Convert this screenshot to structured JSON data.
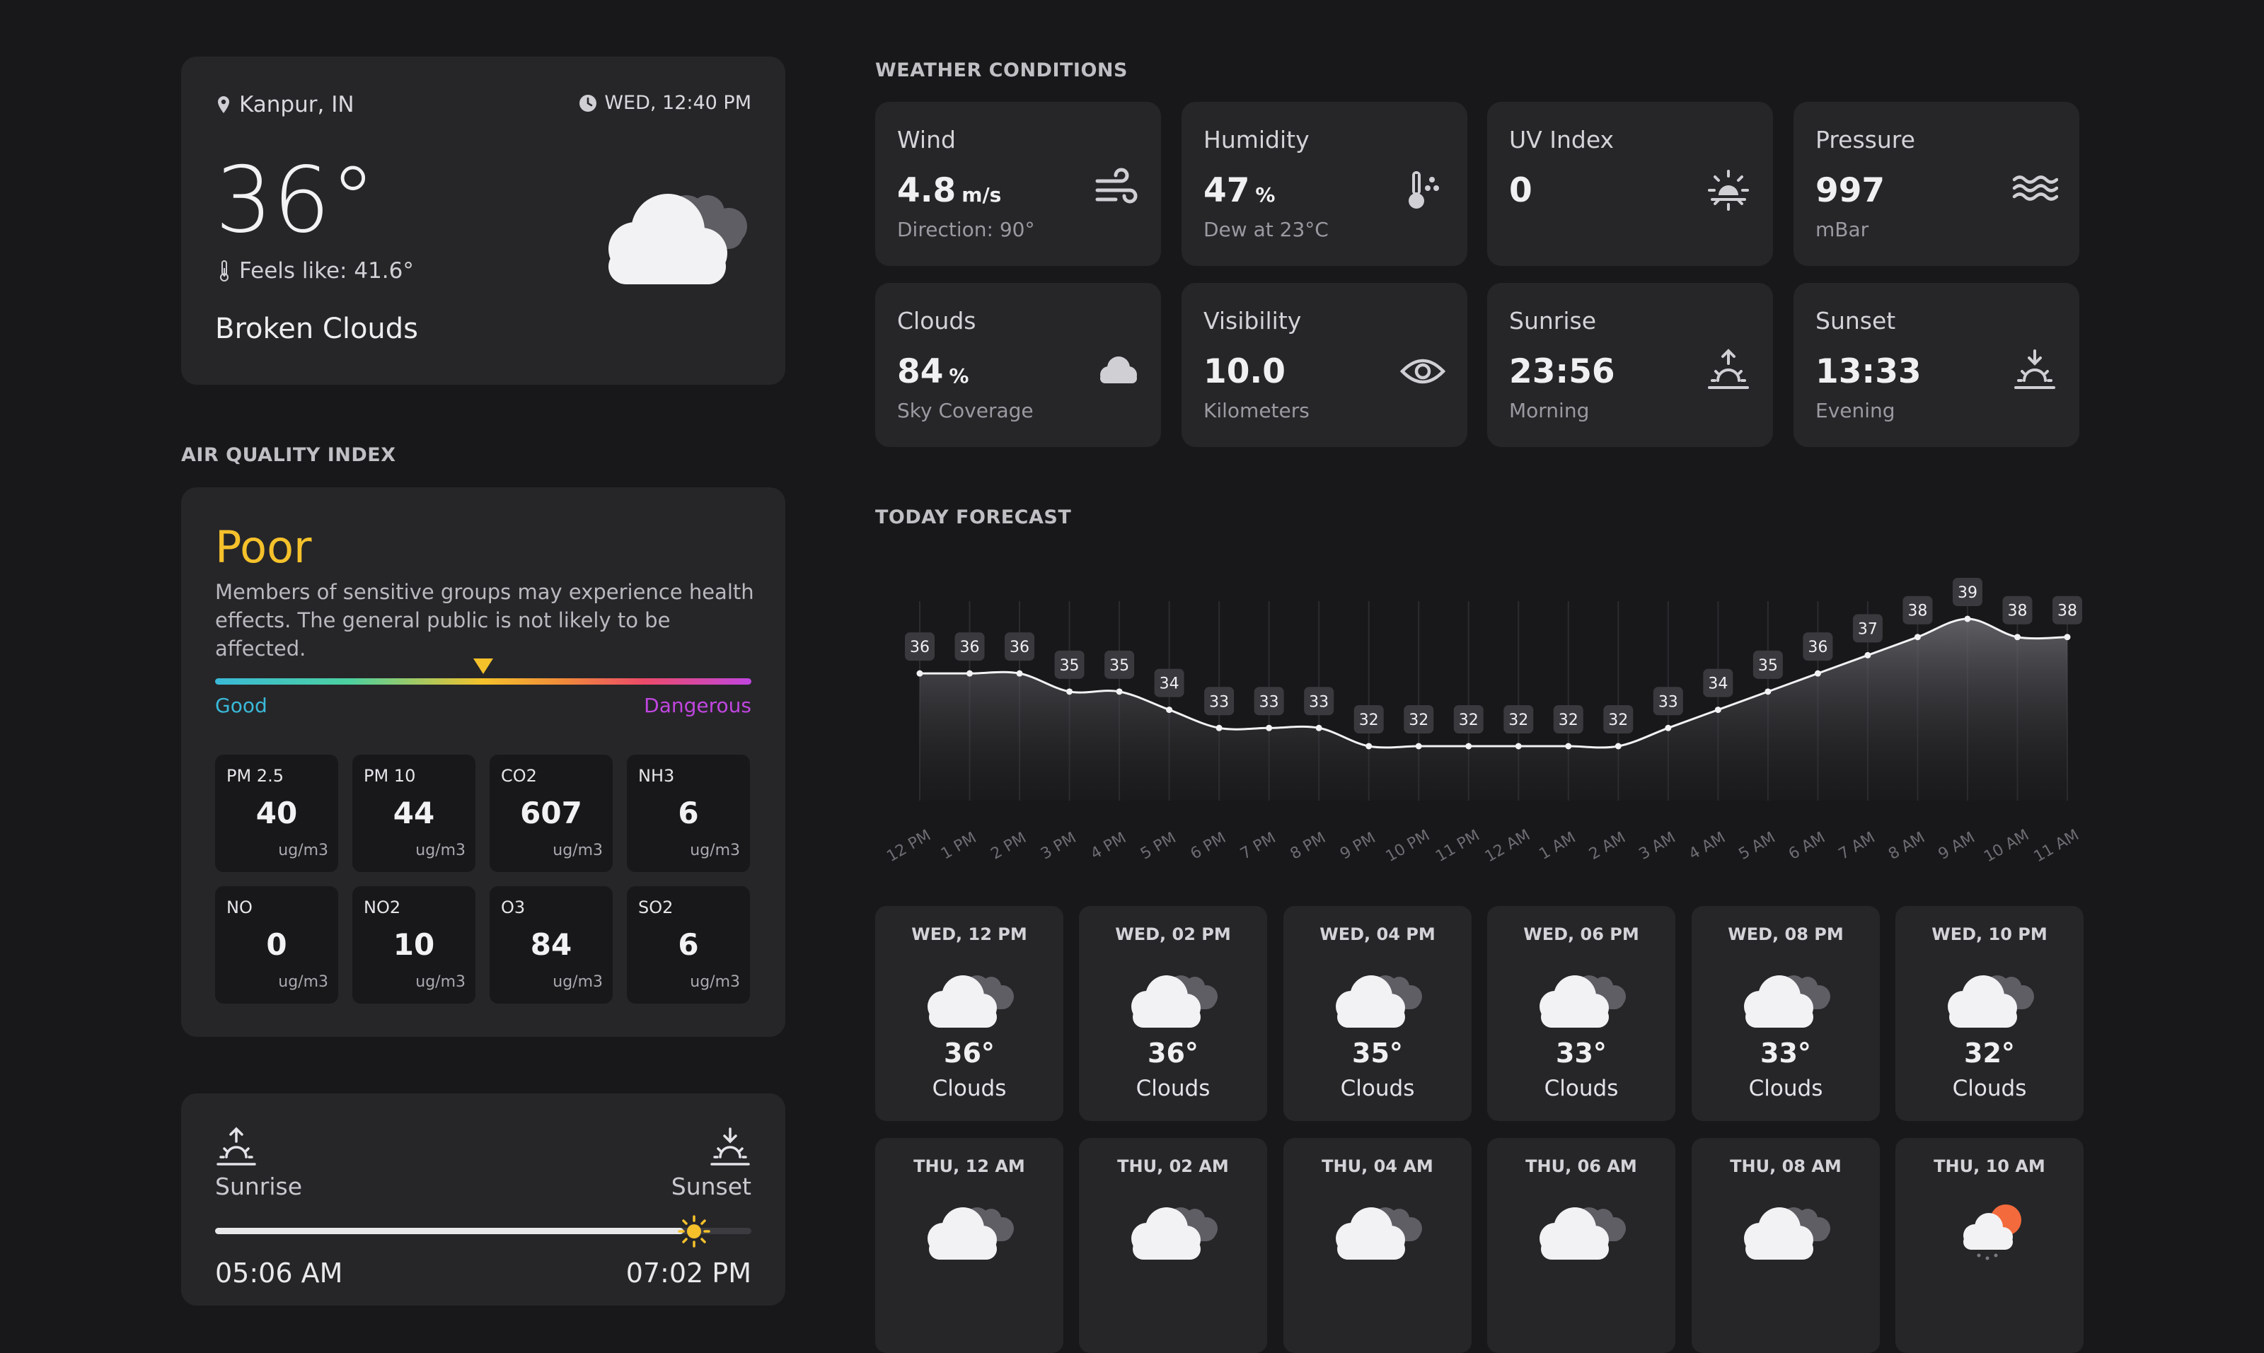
{
  "current": {
    "location": "Kanpur, IN",
    "datetime": "WED, 12:40 PM",
    "temp": "36°",
    "feels_like": "Feels like: 41.6°",
    "condition": "Broken Clouds",
    "icon": "broken-clouds-icon"
  },
  "conditions": {
    "heading": "WEATHER CONDITIONS",
    "tiles": [
      {
        "label": "Wind",
        "value": "4.8",
        "unit": "m/s",
        "sub": "Direction: 90°",
        "icon": "wind-icon"
      },
      {
        "label": "Humidity",
        "value": "47",
        "unit": "%",
        "sub": "Dew at 23°C",
        "icon": "thermometer-droplets-icon"
      },
      {
        "label": "UV Index",
        "value": "0",
        "unit": "",
        "sub": "",
        "icon": "sun-dim-icon"
      },
      {
        "label": "Pressure",
        "value": "997",
        "unit": "",
        "sub": "mBar",
        "icon": "waves-icon"
      },
      {
        "label": "Clouds",
        "value": "84",
        "unit": "%",
        "sub": "Sky Coverage",
        "icon": "cloud-icon"
      },
      {
        "label": "Visibility",
        "value": "10.0",
        "unit": "",
        "sub": "Kilometers",
        "icon": "eye-icon"
      },
      {
        "label": "Sunrise",
        "value": "23:56",
        "unit": "",
        "sub": "Morning",
        "icon": "sunrise-icon"
      },
      {
        "label": "Sunset",
        "value": "13:33",
        "unit": "",
        "sub": "Evening",
        "icon": "sunset-icon"
      }
    ]
  },
  "aqi": {
    "heading": "AIR QUALITY INDEX",
    "level": "Poor",
    "description": "Members of sensitive groups may experience health effects. The general public is not likely to be affected.",
    "scale_low": "Good",
    "scale_high": "Dangerous",
    "marker_fraction": 0.5,
    "pollutants": [
      {
        "name": "PM 2.5",
        "value": "40",
        "unit": "ug/m3"
      },
      {
        "name": "PM 10",
        "value": "44",
        "unit": "ug/m3"
      },
      {
        "name": "CO2",
        "value": "607",
        "unit": "ug/m3"
      },
      {
        "name": "NH3",
        "value": "6",
        "unit": "ug/m3"
      },
      {
        "name": "NO",
        "value": "0",
        "unit": "ug/m3"
      },
      {
        "name": "NO2",
        "value": "10",
        "unit": "ug/m3"
      },
      {
        "name": "O3",
        "value": "84",
        "unit": "ug/m3"
      },
      {
        "name": "SO2",
        "value": "6",
        "unit": "ug/m3"
      }
    ]
  },
  "sun": {
    "sunrise_label": "Sunrise",
    "sunset_label": "Sunset",
    "sunrise_time": "05:06 AM",
    "sunset_time": "07:02 PM",
    "progress": 0.9
  },
  "forecast": {
    "heading": "TODAY FORECAST",
    "cards": [
      {
        "time": "WED, 12 PM",
        "temp": "36°",
        "desc": "Clouds",
        "icon": "cloud-icon"
      },
      {
        "time": "WED, 02 PM",
        "temp": "36°",
        "desc": "Clouds",
        "icon": "cloud-icon"
      },
      {
        "time": "WED, 04 PM",
        "temp": "35°",
        "desc": "Clouds",
        "icon": "cloud-icon"
      },
      {
        "time": "WED, 06 PM",
        "temp": "33°",
        "desc": "Clouds",
        "icon": "cloud-icon"
      },
      {
        "time": "WED, 08 PM",
        "temp": "33°",
        "desc": "Clouds",
        "icon": "cloud-icon"
      },
      {
        "time": "WED, 10 PM",
        "temp": "32°",
        "desc": "Clouds",
        "icon": "cloud-icon"
      },
      {
        "time": "THU, 12 AM",
        "temp": "",
        "desc": "",
        "icon": "cloud-icon"
      },
      {
        "time": "THU, 02 AM",
        "temp": "",
        "desc": "",
        "icon": "cloud-icon"
      },
      {
        "time": "THU, 04 AM",
        "temp": "",
        "desc": "",
        "icon": "cloud-icon"
      },
      {
        "time": "THU, 06 AM",
        "temp": "",
        "desc": "",
        "icon": "cloud-icon"
      },
      {
        "time": "THU, 08 AM",
        "temp": "",
        "desc": "",
        "icon": "cloud-icon"
      },
      {
        "time": "THU, 10 AM",
        "temp": "",
        "desc": "",
        "icon": "sun-rain-cloud-icon"
      }
    ]
  },
  "chart_data": {
    "type": "area",
    "x": [
      "12 PM",
      "1 PM",
      "2 PM",
      "3 PM",
      "4 PM",
      "5 PM",
      "6 PM",
      "7 PM",
      "8 PM",
      "9 PM",
      "10 PM",
      "11 PM",
      "12 AM",
      "1 AM",
      "2 AM",
      "3 AM",
      "4 AM",
      "5 AM",
      "6 AM",
      "7 AM",
      "8 AM",
      "9 AM",
      "10 AM",
      "11 AM"
    ],
    "series": [
      {
        "values": [
          36,
          36,
          36,
          35,
          35,
          34,
          33,
          33,
          33,
          32,
          32,
          32,
          32,
          32,
          32,
          33,
          34,
          35,
          36,
          37,
          38,
          39,
          38,
          38
        ]
      }
    ],
    "grid": true,
    "legend": "none"
  },
  "colors": {
    "background": "#18181a",
    "card": "#262629",
    "aqi_poor": "#f5c12b",
    "good": "#3ab9d8",
    "dangerous": "#c146e0"
  }
}
